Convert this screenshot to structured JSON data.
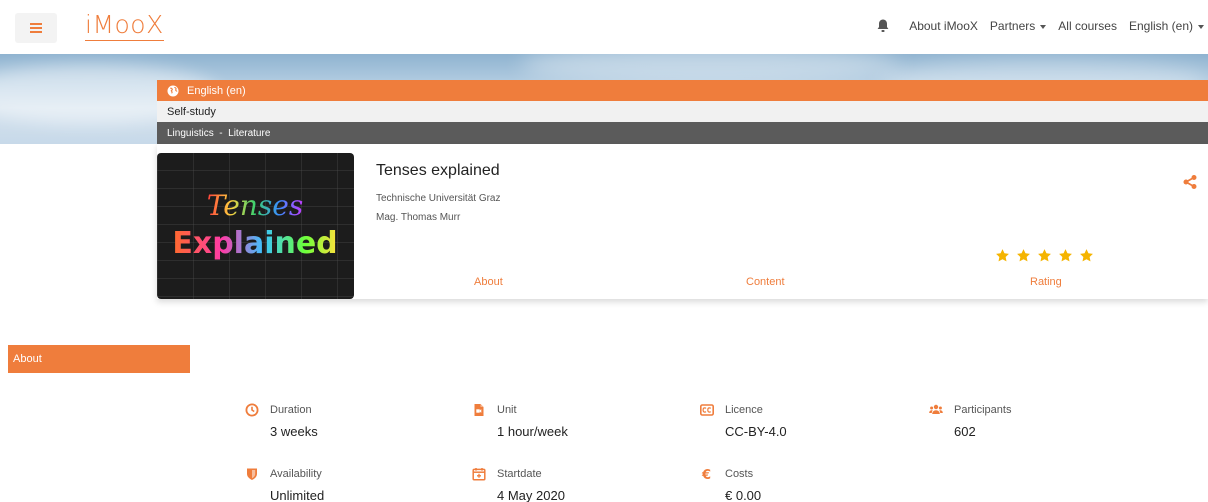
{
  "navbar": {
    "logo": "iMooX",
    "links": {
      "about": "About iMooX",
      "partners": "Partners",
      "all_courses": "All courses",
      "language": "English (en)"
    }
  },
  "course_header": {
    "language": "English (en)",
    "mode": "Self-study",
    "categories": "Linguistics  -  Literature"
  },
  "course": {
    "title": "Tenses explained",
    "university": "Technische Universität Graz",
    "author": "Mag. Thomas Murr",
    "image_text_top": "Tenses",
    "image_text_bottom": "Explained",
    "rating_stars": 5,
    "tabs": {
      "about": "About",
      "content": "Content",
      "rating": "Rating"
    }
  },
  "about_section": {
    "title": "About",
    "facts": {
      "duration": {
        "label": "Duration",
        "value": "3 weeks"
      },
      "unit": {
        "label": "Unit",
        "value": "1 hour/week"
      },
      "licence": {
        "label": "Licence",
        "value": "CC-BY-4.0"
      },
      "participants": {
        "label": "Participants",
        "value": "602"
      },
      "availability": {
        "label": "Availability",
        "value": "Unlimited"
      },
      "startdate": {
        "label": "Startdate",
        "value": "4 May 2020"
      },
      "costs": {
        "label": "Costs",
        "value": "€ 0.00"
      }
    }
  },
  "colors": {
    "accent": "#ef7d3c",
    "star": "#f5b400",
    "category_bar": "#5b5b5b"
  }
}
